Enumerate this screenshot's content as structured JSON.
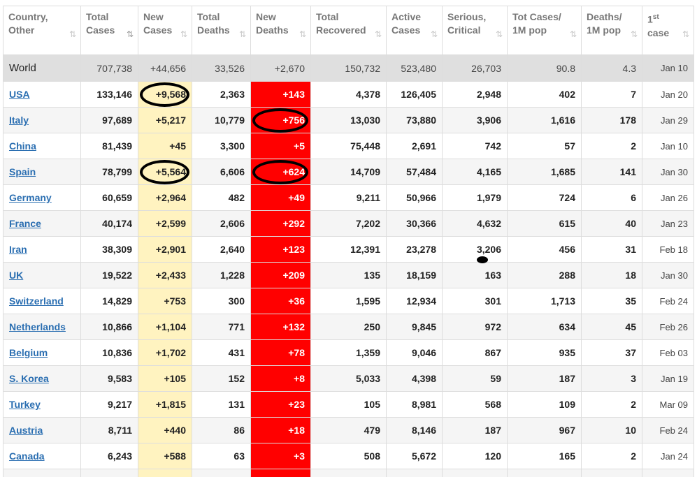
{
  "headers": [
    {
      "line1": "Country,",
      "line2": "Other",
      "sort": "⇅"
    },
    {
      "line1": "Total",
      "line2": "Cases",
      "sort": "⇅"
    },
    {
      "line1": "New",
      "line2": "Cases",
      "sort": "⇅"
    },
    {
      "line1": "Total",
      "line2": "Deaths",
      "sort": "⇅"
    },
    {
      "line1": "New",
      "line2": "Deaths",
      "sort": "⇅"
    },
    {
      "line1": "Total",
      "line2": "Recovered",
      "sort": "⇅"
    },
    {
      "line1": "Active",
      "line2": "Cases",
      "sort": "⇅"
    },
    {
      "line1": "Serious,",
      "line2": "Critical",
      "sort": "⇅"
    },
    {
      "line1": "Tot Cases/",
      "line2": "1M pop",
      "sort": "⇅"
    },
    {
      "line1": "Deaths/",
      "line2": "1M pop",
      "sort": "⇅"
    },
    {
      "line1": "1st",
      "line2": "case",
      "sort": "⇅"
    }
  ],
  "world": [
    "World",
    "707,738",
    "+44,656",
    "33,526",
    "+2,670",
    "150,732",
    "523,480",
    "26,703",
    "90.8",
    "4.3",
    "Jan 10"
  ],
  "rows": [
    [
      "USA",
      "133,146",
      "+9,568",
      "2,363",
      "+143",
      "4,378",
      "126,405",
      "2,948",
      "402",
      "7",
      "Jan 20"
    ],
    [
      "Italy",
      "97,689",
      "+5,217",
      "10,779",
      "+756",
      "13,030",
      "73,880",
      "3,906",
      "1,616",
      "178",
      "Jan 29"
    ],
    [
      "China",
      "81,439",
      "+45",
      "3,300",
      "+5",
      "75,448",
      "2,691",
      "742",
      "57",
      "2",
      "Jan 10"
    ],
    [
      "Spain",
      "78,799",
      "+5,564",
      "6,606",
      "+624",
      "14,709",
      "57,484",
      "4,165",
      "1,685",
      "141",
      "Jan 30"
    ],
    [
      "Germany",
      "60,659",
      "+2,964",
      "482",
      "+49",
      "9,211",
      "50,966",
      "1,979",
      "724",
      "6",
      "Jan 26"
    ],
    [
      "France",
      "40,174",
      "+2,599",
      "2,606",
      "+292",
      "7,202",
      "30,366",
      "4,632",
      "615",
      "40",
      "Jan 23"
    ],
    [
      "Iran",
      "38,309",
      "+2,901",
      "2,640",
      "+123",
      "12,391",
      "23,278",
      "3,206",
      "456",
      "31",
      "Feb 18"
    ],
    [
      "UK",
      "19,522",
      "+2,433",
      "1,228",
      "+209",
      "135",
      "18,159",
      "163",
      "288",
      "18",
      "Jan 30"
    ],
    [
      "Switzerland",
      "14,829",
      "+753",
      "300",
      "+36",
      "1,595",
      "12,934",
      "301",
      "1,713",
      "35",
      "Feb 24"
    ],
    [
      "Netherlands",
      "10,866",
      "+1,104",
      "771",
      "+132",
      "250",
      "9,845",
      "972",
      "634",
      "45",
      "Feb 26"
    ],
    [
      "Belgium",
      "10,836",
      "+1,702",
      "431",
      "+78",
      "1,359",
      "9,046",
      "867",
      "935",
      "37",
      "Feb 03"
    ],
    [
      "S. Korea",
      "9,583",
      "+105",
      "152",
      "+8",
      "5,033",
      "4,398",
      "59",
      "187",
      "3",
      "Jan 19"
    ],
    [
      "Turkey",
      "9,217",
      "+1,815",
      "131",
      "+23",
      "105",
      "8,981",
      "568",
      "109",
      "2",
      "Mar 09"
    ],
    [
      "Austria",
      "8,711",
      "+440",
      "86",
      "+18",
      "479",
      "8,146",
      "187",
      "967",
      "10",
      "Feb 24"
    ],
    [
      "Canada",
      "6,243",
      "+588",
      "63",
      "+3",
      "508",
      "5,672",
      "120",
      "165",
      "2",
      "Jan 24"
    ],
    [
      "",
      "",
      "",
      "",
      "",
      "",
      "",
      "",
      "",
      "",
      ""
    ]
  ],
  "colors": {
    "new_cases_bg": "#fff3c0",
    "new_deaths_bg": "#ff0000",
    "country_link": "#2a6eb1",
    "world_row_bg": "#dfdfdf",
    "annotation": "#000000"
  },
  "annotations": {
    "circled_cells": [
      {
        "row": 0,
        "col": 2
      },
      {
        "row": 1,
        "col": 4
      },
      {
        "row": 3,
        "col": 2
      },
      {
        "row": 3,
        "col": 4
      }
    ],
    "dot_cells": [
      {
        "row": 6,
        "col": 7
      }
    ]
  },
  "sort": {
    "active_column": 1
  }
}
